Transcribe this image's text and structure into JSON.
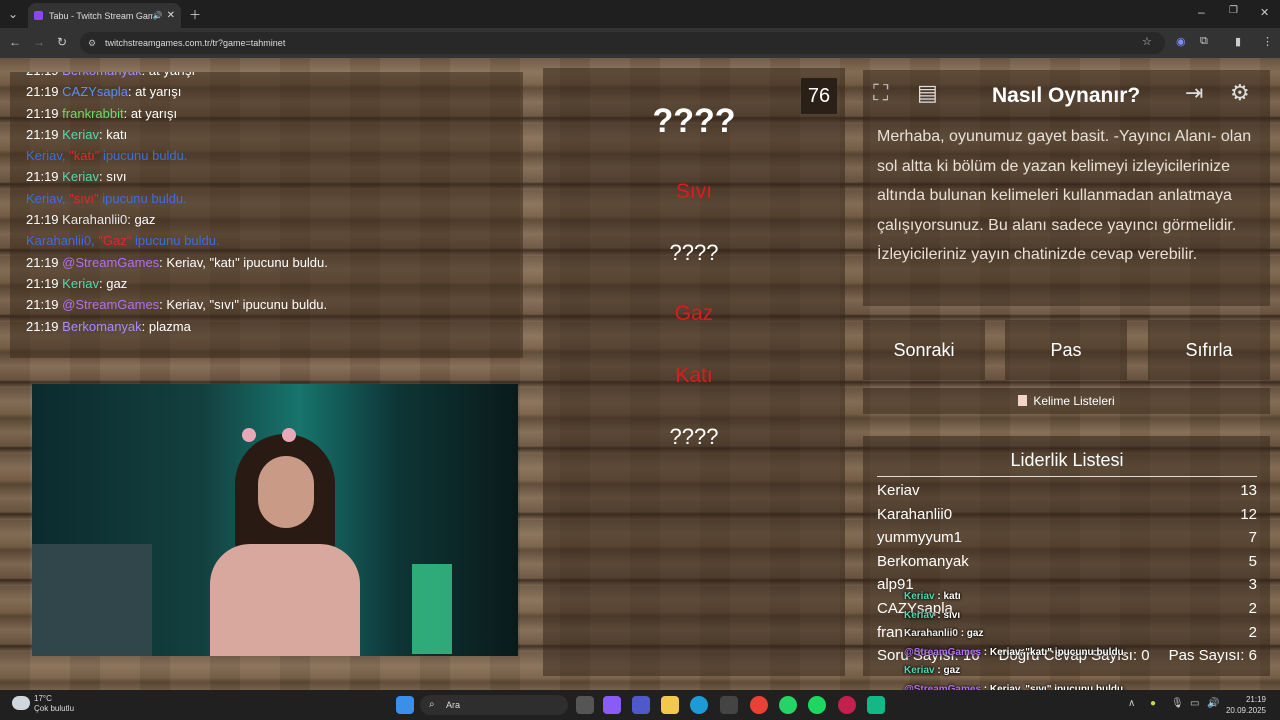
{
  "browser": {
    "tab_title": "Tabu - Twitch Stream Games",
    "url": "twitchstreamgames.com.tr/tr?game=tahminet"
  },
  "chat": [
    {
      "time": "21:19",
      "user": "Berkomanyak",
      "cls": "u-purple",
      "msg": "at yarışı"
    },
    {
      "time": "21:19",
      "user": "CAZYsapla",
      "cls": "u-blue",
      "msg": "at yarışı"
    },
    {
      "time": "21:19",
      "user": "frankrabbit",
      "cls": "u-green",
      "msg": "at yarışı"
    },
    {
      "time": "21:19",
      "user": "Keriav",
      "cls": "u-teal",
      "msg": "katı"
    },
    {
      "sys": true,
      "user": "Keriav",
      "cls": "",
      "word": "\"katı\"",
      "msg": "ipucunu buldu."
    },
    {
      "time": "21:19",
      "user": "Keriav",
      "cls": "u-teal",
      "msg": "sıvı"
    },
    {
      "sys": true,
      "user": "Keriav",
      "cls": "",
      "word": "\"sıvı\"",
      "msg": "ipucunu buldu."
    },
    {
      "time": "21:19",
      "user": "Karahanlii0",
      "cls": "u-gray",
      "msg": "gaz"
    },
    {
      "sys": true,
      "user": "Karahanlii0",
      "cls": "",
      "word": "\"Gaz\"",
      "msg": "ipucunu buldu."
    },
    {
      "time": "21:19",
      "user": "@StreamGames",
      "cls": "u-mag",
      "msg": "Keriav, \"katı\" ipucunu buldu."
    },
    {
      "time": "21:19",
      "user": "Keriav",
      "cls": "u-teal",
      "msg": "gaz"
    },
    {
      "time": "21:19",
      "user": "@StreamGames",
      "cls": "u-mag",
      "msg": "Keriav, \"sıvı\" ipucunu buldu."
    },
    {
      "time": "21:19",
      "user": "Berkomanyak",
      "cls": "u-purple",
      "msg": "plazma"
    }
  ],
  "game": {
    "timer": "76",
    "main_word": "????",
    "hints": [
      {
        "text": "Sıvı",
        "found": true
      },
      {
        "text": "????",
        "found": false
      },
      {
        "text": "Gaz",
        "found": true
      },
      {
        "text": "Katı",
        "found": true
      },
      {
        "text": "????",
        "found": false
      }
    ]
  },
  "howto": {
    "title": "Nasıl Oynanır?",
    "text": "Merhaba, oyunumuz gayet basit. -Yayıncı Alanı- olan sol altta ki bölüm de yazan kelimeyi izleyicilerinize altında bulunan kelimeleri kullanmadan anlatmaya çalışıyorsunuz. Bu alanı sadece yayıncı görmelidir. İzleyicileriniz yayın chatinizde cevap verebilir."
  },
  "buttons": {
    "next": "Sonraki",
    "pass": "Pas",
    "reset": "Sıfırla",
    "lists": "Kelime Listeleri"
  },
  "leaderboard": {
    "title": "Liderlik Listesi",
    "rows": [
      {
        "name": "Keriav",
        "score": "13"
      },
      {
        "name": "Karahanlii0",
        "score": "12"
      },
      {
        "name": "yummyyum1",
        "score": "7"
      },
      {
        "name": "Berkomanyak",
        "score": "5"
      },
      {
        "name": "alp91",
        "score": "3"
      },
      {
        "name": "CAZYsapla",
        "score": "2"
      },
      {
        "name": "fran",
        "score": "2"
      }
    ],
    "footer_left": "Soru Sayısı: 16",
    "footer_mid": "Doğru Cevap Sayısı: 0",
    "footer_right": "Pas Sayısı: 6"
  },
  "overlay_chat": [
    {
      "user": "Keriav",
      "cls": "u-teal",
      "msg": " : katı"
    },
    {
      "user": "Keriav",
      "cls": "u-teal",
      "msg": " : sıvı"
    },
    {
      "user": "Karahanlii0",
      "cls": "u-gray",
      "msg": " : gaz"
    },
    {
      "user": "@StreamGames",
      "cls": "u-mag",
      "msg": " : Keriav, \"katı\" ipucunu buldu."
    },
    {
      "user": "Keriav",
      "cls": "u-teal",
      "msg": " : gaz"
    },
    {
      "user": "@StreamGames",
      "cls": "u-mag",
      "msg": " : Keriav, \"sıvı\" ipucunu buldu."
    }
  ],
  "taskbar": {
    "temp": "17°C",
    "weather": "Çok bulutlu",
    "search": "Ara",
    "time": "21:19",
    "date": "20.09.2025"
  }
}
